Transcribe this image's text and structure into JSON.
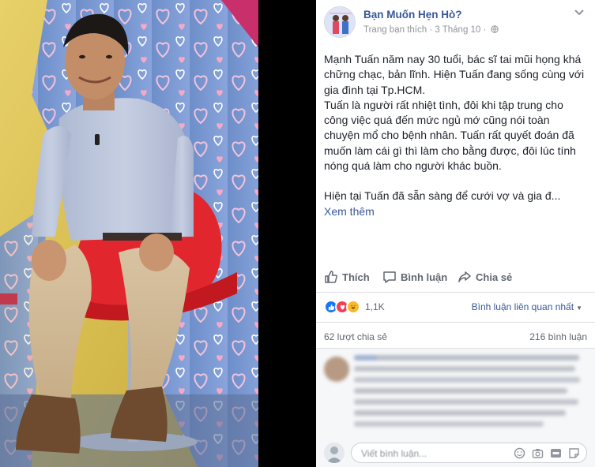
{
  "post": {
    "page_name": "Bạn Muốn Hẹn Hò?",
    "meta_prefix": "Trang bạn thích · 3 Tháng 10 ·",
    "paragraph1": "Mạnh Tuấn năm nay 30 tuổi, bác sĩ tai mũi họng khá chững chạc, bản lĩnh. Hiện Tuấn đang sống cùng với gia đình tại Tp.HCM.",
    "paragraph2": "Tuấn là người rất nhiệt tình, đôi khi tập trung cho công việc quá đến mức ngủ mớ cũng nói toàn chuyện mổ cho bệnh nhân. Tuấn rất quyết đoán đã muốn làm cái gì thì làm cho bằng được, đôi lúc tính nóng quá làm cho người khác buồn.",
    "paragraph3": "Hiện tại Tuấn đã sẵn sàng để cưới vợ và gia đ...",
    "see_more": "Xem thêm"
  },
  "actions": {
    "like": "Thích",
    "comment": "Bình luận",
    "share": "Chia sẻ"
  },
  "stats": {
    "reactions": "1,1K",
    "related_label": "Bình luận liên quan nhất",
    "shares": "62 lượt chia sẻ",
    "comments": "216 bình luận"
  },
  "composer": {
    "placeholder": "Viết bình luận..."
  },
  "icons": {
    "like": "thumbs-up-icon",
    "comment": "speech-bubble-icon",
    "share": "share-arrow-icon",
    "globe": "globe-icon",
    "chevron": "chevron-down-icon",
    "emoji": "emoji-icon",
    "camera": "camera-icon",
    "gif": "gif-icon",
    "sticker": "sticker-icon"
  },
  "colors": {
    "link": "#385898",
    "like_reaction": "#1877f2",
    "love_reaction": "#f33e58",
    "haha_reaction": "#f7b928",
    "backdrop": "#000000"
  }
}
